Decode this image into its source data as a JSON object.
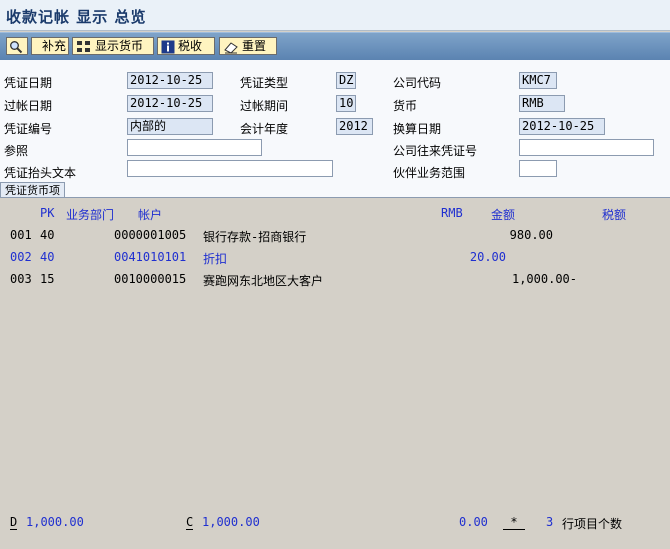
{
  "title": "收款记帐 显示 总览",
  "toolbar": {
    "items": [
      {
        "name": "magnify-button",
        "label": ""
      },
      {
        "name": "supplement-button",
        "label": "补充"
      },
      {
        "name": "show-currency-button",
        "label": "显示货币"
      },
      {
        "name": "tax-button",
        "label": "税收"
      },
      {
        "name": "reset-button",
        "label": "重置"
      }
    ]
  },
  "header": {
    "doc_date_label": "凭证日期",
    "doc_date": "2012-10-25",
    "doc_type_label": "凭证类型",
    "doc_type": "DZ",
    "company_code_label": "公司代码",
    "company_code": "KMC7",
    "post_date_label": "过帐日期",
    "post_date": "2012-10-25",
    "period_label": "过帐期间",
    "period": "10",
    "currency_label": "货币",
    "currency": "RMB",
    "doc_no_label": "凭证编号",
    "doc_no": "内部的",
    "fiscal_year_label": "会计年度",
    "fiscal_year": "2012",
    "trans_date_label": "换算日期",
    "trans_date": "2012-10-25",
    "ref_label": "参照",
    "ref": "",
    "intercompany_label": "公司往来凭证号",
    "intercompany": "",
    "header_text_label": "凭证抬头文本",
    "header_text": "",
    "partner_area_label": "伙伴业务范围",
    "partner_area": ""
  },
  "tab_label": "凭证货币项",
  "items": {
    "columns": {
      "pk": "PK",
      "bus_area": "业务部门",
      "account": "帐户",
      "currency": "RMB",
      "amount": "金额",
      "tax": "税额"
    },
    "rows": [
      {
        "no": "001",
        "pk": "40",
        "account": "0000001005",
        "text": "银行存款-招商银行",
        "amount": "980.00",
        "highlight": false
      },
      {
        "no": "002",
        "pk": "40",
        "account": "0041010101",
        "text": "折扣",
        "amount": "20.00",
        "highlight": true
      },
      {
        "no": "003",
        "pk": "15",
        "account": "0010000015",
        "text": "赛跑网东北地区大客户",
        "amount": "1,000.00-",
        "highlight": false
      }
    ]
  },
  "footer": {
    "d_label": "D",
    "d_value": "1,000.00",
    "c_label": "C",
    "c_value": "1,000.00",
    "balance": "0.00",
    "star": "*",
    "count": "3",
    "count_label": "行项目个数"
  },
  "colors": {
    "accent": "#1f2fd0",
    "toolbar": "#5b83b1",
    "field_ro": "#dce6f4"
  }
}
